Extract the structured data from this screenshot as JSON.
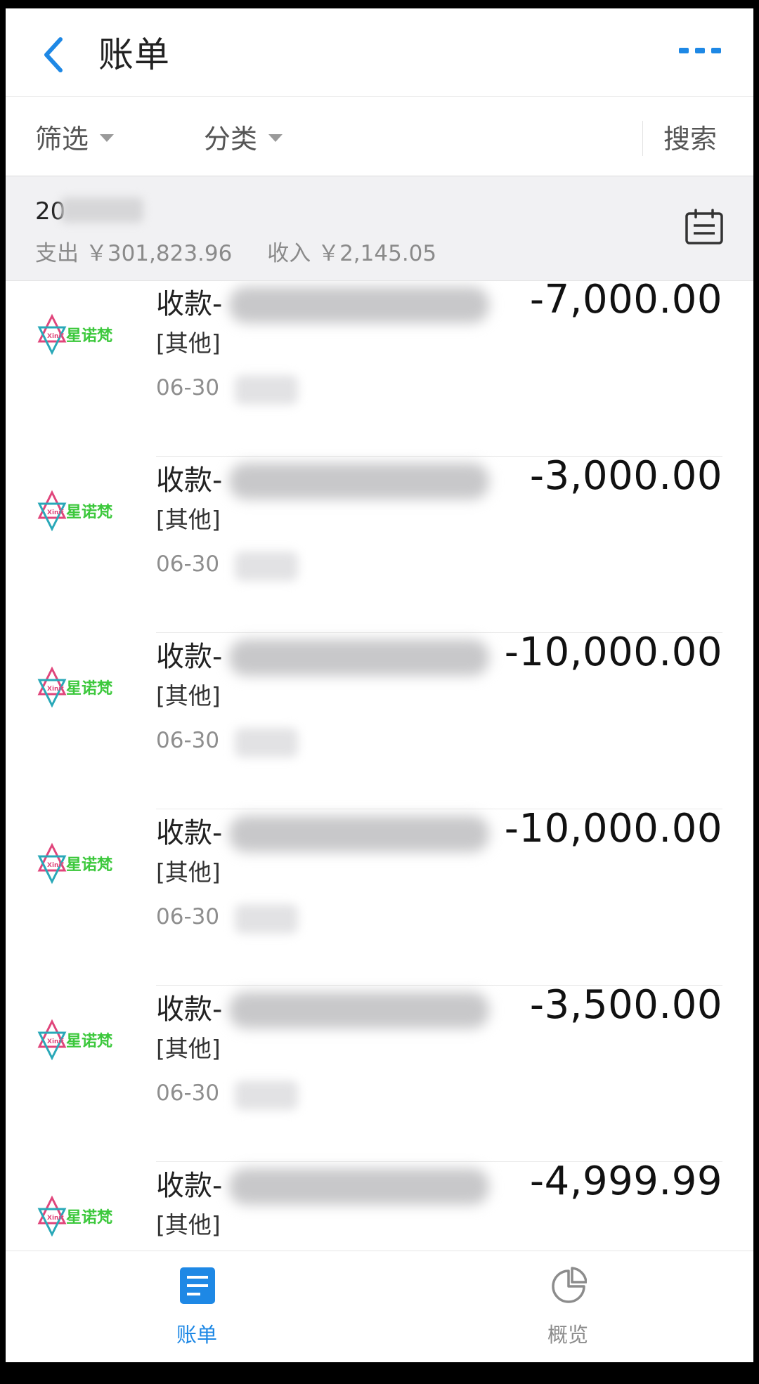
{
  "header": {
    "title": "账单"
  },
  "filters": {
    "filter_label": "筛选",
    "category_label": "分类",
    "search_label": "搜索"
  },
  "summary": {
    "month_visible": "20",
    "expense": "支出 ￥301,823.96",
    "income": "收入 ￥2,145.05"
  },
  "transactions": [
    {
      "payee_prefix": "收款-",
      "category": "[其他]",
      "date": "06-30",
      "amount": "-7,000.00"
    },
    {
      "payee_prefix": "收款-",
      "category": "[其他]",
      "date": "06-30",
      "amount": "-3,000.00"
    },
    {
      "payee_prefix": "收款-",
      "category": "[其他]",
      "date": "06-30",
      "amount": "-10,000.00"
    },
    {
      "payee_prefix": "收款-",
      "category": "[其他]",
      "date": "06-30",
      "amount": "-10,000.00"
    },
    {
      "payee_prefix": "收款-",
      "category": "[其他]",
      "date": "06-30",
      "amount": "-3,500.00"
    },
    {
      "payee_prefix": "收款-",
      "category": "[其他]",
      "date": "",
      "amount": "-4,999.99"
    }
  ],
  "logo": {
    "text": "星诺梵",
    "mark": "Xinif"
  },
  "tabs": [
    {
      "label": "账单",
      "icon": "bill-icon",
      "active": true
    },
    {
      "label": "概览",
      "icon": "pie-chart-icon",
      "active": false
    }
  ],
  "colors": {
    "accent": "#1e88e5",
    "logo_green": "#3cc83c",
    "logo_pink": "#e0457b",
    "logo_teal": "#29a8b8",
    "inactive": "#8c8c8c"
  }
}
